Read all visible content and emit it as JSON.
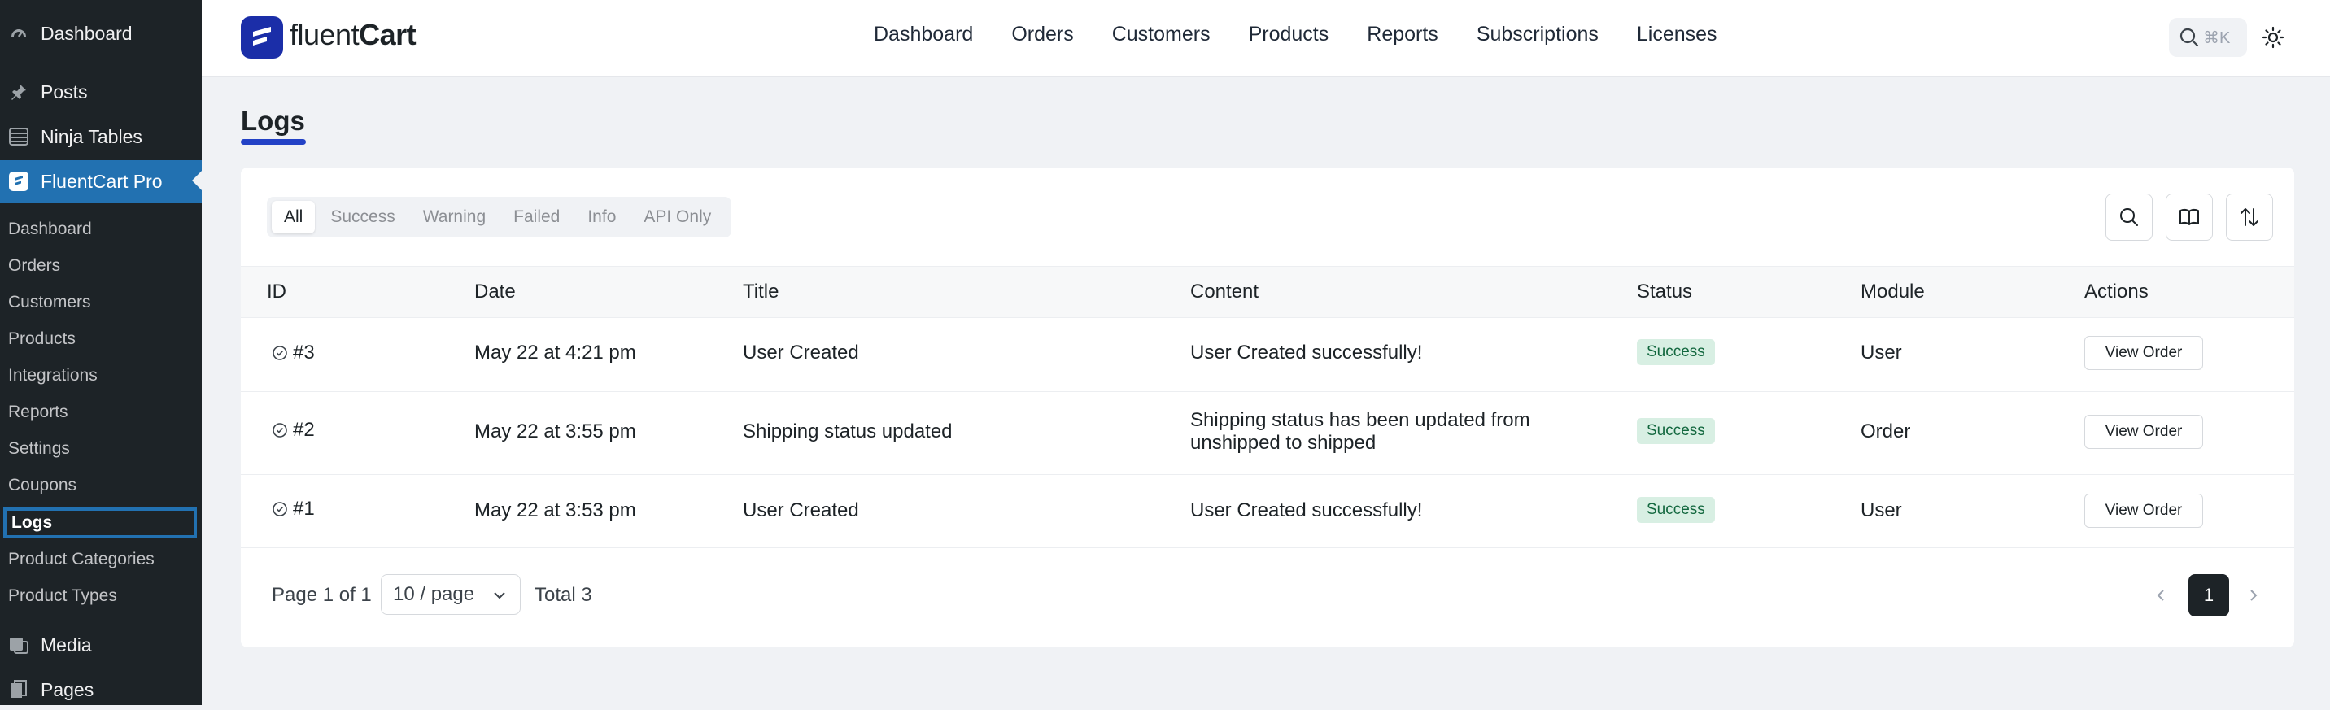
{
  "wp_menu": {
    "dashboard": "Dashboard",
    "posts": "Posts",
    "ninja_tables": "Ninja Tables",
    "fluentcart_pro": "FluentCart Pro",
    "submenu": [
      "Dashboard",
      "Orders",
      "Customers",
      "Products",
      "Integrations",
      "Reports",
      "Settings",
      "Coupons",
      "Logs",
      "Product Categories",
      "Product Types"
    ],
    "media": "Media",
    "pages": "Pages"
  },
  "header": {
    "logo_light": "fluent",
    "logo_bold": "Cart",
    "nav": [
      "Dashboard",
      "Orders",
      "Customers",
      "Products",
      "Reports",
      "Subscriptions",
      "Licenses"
    ],
    "search_shortcut": "⌘K"
  },
  "page": {
    "title": "Logs"
  },
  "filters": [
    "All",
    "Success",
    "Warning",
    "Failed",
    "Info",
    "API Only"
  ],
  "table": {
    "columns": [
      "ID",
      "Date",
      "Title",
      "Content",
      "Status",
      "Module",
      "Actions"
    ],
    "rows": [
      {
        "id": "#3",
        "date": "May 22 at 4:21 pm",
        "title": "User Created",
        "content_1": "User Created successfully!",
        "content_2": "",
        "status": "Success",
        "module": "User",
        "action": "View Order"
      },
      {
        "id": "#2",
        "date": "May 22 at 3:55 pm",
        "title": "Shipping status updated",
        "content_1": "Shipping status has been updated from",
        "content_2": "unshipped to shipped",
        "status": "Success",
        "module": "Order",
        "action": "View Order"
      },
      {
        "id": "#1",
        "date": "May 22 at 3:53 pm",
        "title": "User Created",
        "content_1": "User Created successfully!",
        "content_2": "",
        "status": "Success",
        "module": "User",
        "action": "View Order"
      }
    ]
  },
  "pagination": {
    "page_info": "Page 1 of 1",
    "per_page": "10 / page",
    "total": "Total 3",
    "current_page": "1"
  },
  "colors": {
    "wp_sidebar": "#1d2327",
    "wp_active": "#2271b1",
    "brand": "#1b2ea8",
    "success_bg": "#d8efe3",
    "success_text": "#13683f"
  }
}
